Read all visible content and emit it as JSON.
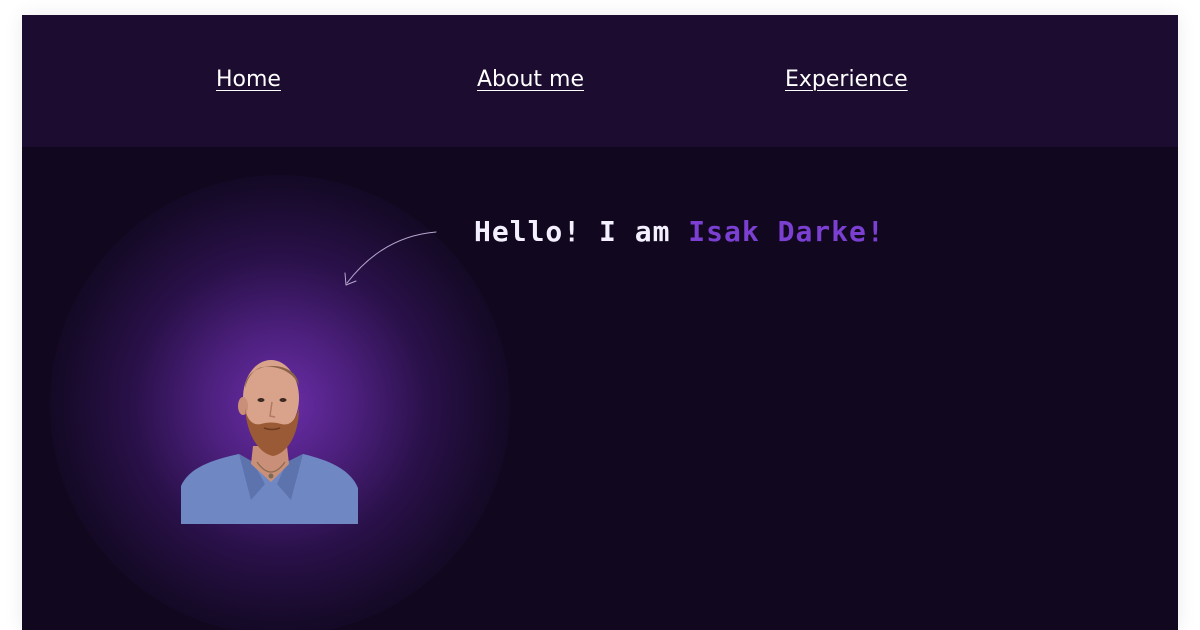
{
  "nav": {
    "items": [
      {
        "label": "Home"
      },
      {
        "label": "About me"
      },
      {
        "label": "Experience"
      }
    ]
  },
  "hero": {
    "greeting_prefix": "Hello! I am ",
    "greeting_name": "Isak Darke!"
  },
  "colors": {
    "page_background": "#110820",
    "navbar_background": "#1c0c30",
    "accent_purple": "#7b3fd1",
    "nav_text": "#ffffff"
  }
}
